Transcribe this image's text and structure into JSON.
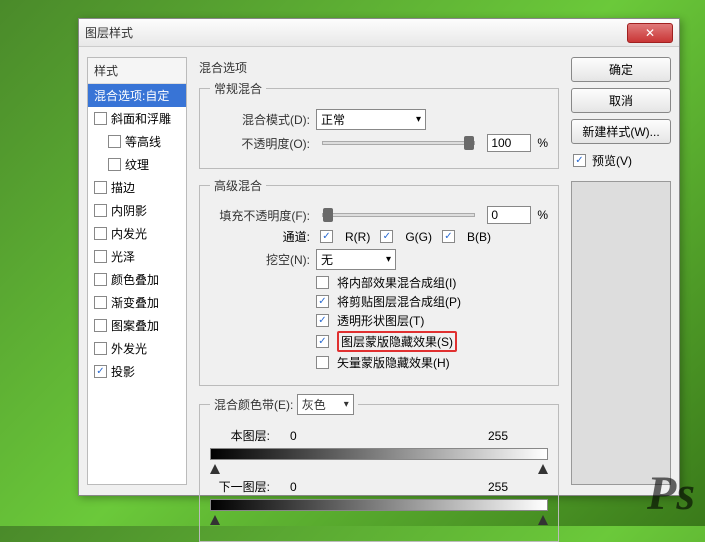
{
  "dialog": {
    "title": "图层样式"
  },
  "left": {
    "header": "样式",
    "items": [
      {
        "label": "混合选项:自定",
        "selected": true
      },
      {
        "label": "斜面和浮雕",
        "checked": false
      },
      {
        "label": "等高线",
        "checked": false,
        "indent": true
      },
      {
        "label": "纹理",
        "checked": false,
        "indent": true
      },
      {
        "label": "描边",
        "checked": false
      },
      {
        "label": "内阴影",
        "checked": false
      },
      {
        "label": "内发光",
        "checked": false
      },
      {
        "label": "光泽",
        "checked": false
      },
      {
        "label": "颜色叠加",
        "checked": false
      },
      {
        "label": "渐变叠加",
        "checked": false
      },
      {
        "label": "图案叠加",
        "checked": false
      },
      {
        "label": "外发光",
        "checked": false
      },
      {
        "label": "投影",
        "checked": true
      }
    ]
  },
  "center": {
    "title": "混合选项",
    "normal": {
      "legend": "常规混合",
      "mode_label": "混合模式(D):",
      "mode_value": "正常",
      "opacity_label": "不透明度(O):",
      "opacity_value": "100",
      "opacity_unit": "%"
    },
    "adv": {
      "legend": "高级混合",
      "fill_label": "填充不透明度(F):",
      "fill_value": "0",
      "fill_unit": "%",
      "channel_label": "通道:",
      "ch_r": "R(R)",
      "ch_g": "G(G)",
      "ch_b": "B(B)",
      "knockout_label": "挖空(N):",
      "knockout_value": "无",
      "c1": "将内部效果混合成组(I)",
      "c2": "将剪贴图层混合成组(P)",
      "c3": "透明形状图层(T)",
      "c4": "图层蒙版隐藏效果(S)",
      "c5": "矢量蒙版隐藏效果(H)"
    },
    "blendif": {
      "legend": "混合颜色带(E):",
      "gray": "灰色",
      "this_label": "本图层:",
      "this_low": "0",
      "this_high": "255",
      "under_label": "下一图层:",
      "under_low": "0",
      "under_high": "255"
    }
  },
  "right": {
    "ok": "确定",
    "cancel": "取消",
    "newstyle": "新建样式(W)...",
    "preview": "预览(V)"
  },
  "watermark": "Ps"
}
